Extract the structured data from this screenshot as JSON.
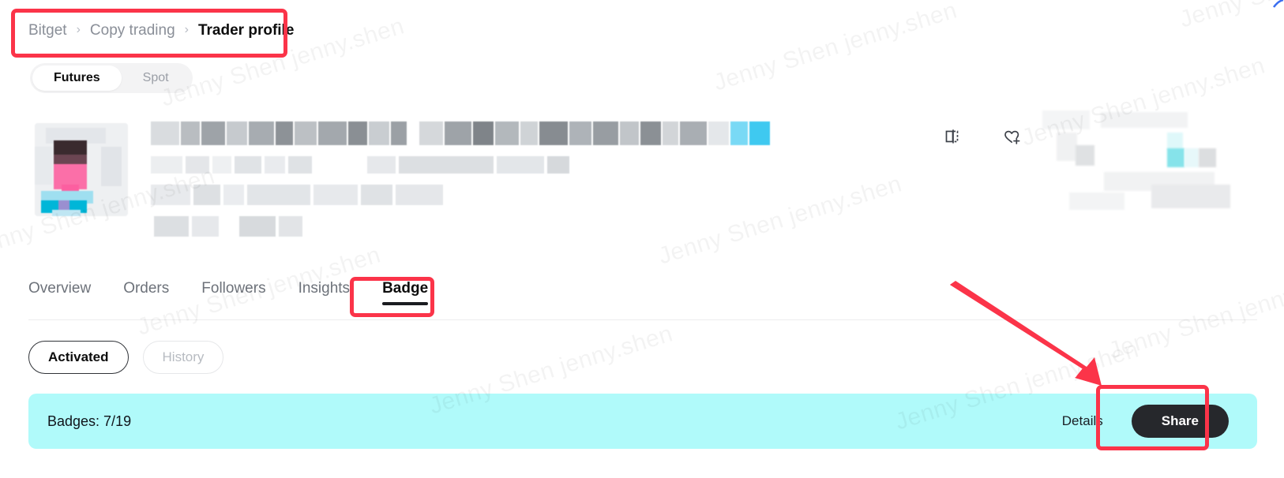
{
  "breadcrumb": {
    "items": [
      {
        "label": "Bitget",
        "current": false
      },
      {
        "label": "Copy trading",
        "current": false
      },
      {
        "label": "Trader profile",
        "current": true
      }
    ],
    "separator": "›"
  },
  "market_switch": {
    "options": [
      {
        "label": "Futures",
        "active": true
      },
      {
        "label": "Spot",
        "active": false
      }
    ]
  },
  "profile": {
    "redacted": true,
    "avatar_icon": "avatar-image",
    "actions": [
      {
        "icon": "compare-panels-icon"
      },
      {
        "icon": "heart-plus-icon"
      }
    ]
  },
  "tabs": [
    {
      "label": "Overview",
      "active": false
    },
    {
      "label": "Orders",
      "active": false
    },
    {
      "label": "Followers",
      "active": false
    },
    {
      "label": "Insights",
      "active": false
    },
    {
      "label": "Badge",
      "active": true
    }
  ],
  "filters": [
    {
      "label": "Activated",
      "selected": true
    },
    {
      "label": "History",
      "selected": false
    }
  ],
  "badge_banner": {
    "title": "Badges: 7/19",
    "details_label": "Details",
    "share_label": "Share",
    "background_color": "#B0FAFA"
  },
  "annotations": {
    "highlight_color": "#FB3449",
    "boxes": [
      {
        "target": "breadcrumb"
      },
      {
        "target": "badge-tab"
      },
      {
        "target": "share-button"
      }
    ],
    "arrow": {
      "points_to": "share-button"
    }
  },
  "watermark": {
    "text": "Jenny Shen jenny.shen"
  }
}
